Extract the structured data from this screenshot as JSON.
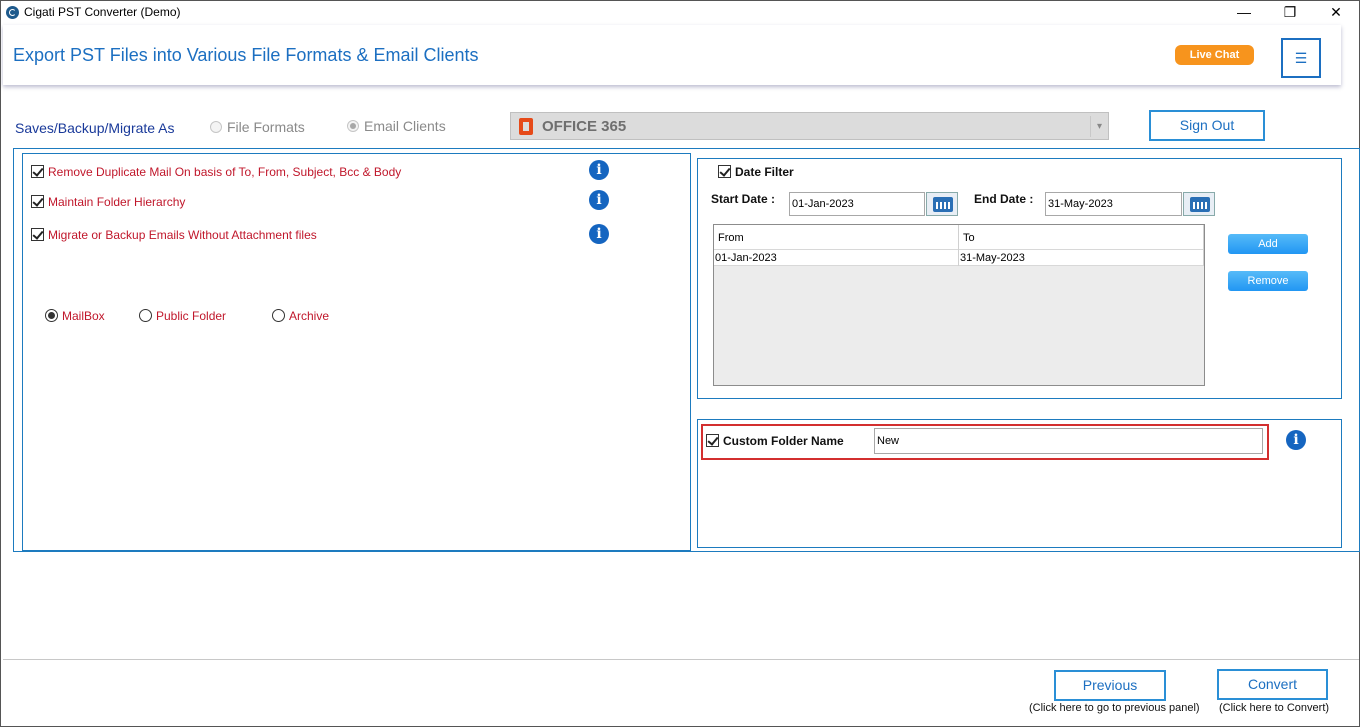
{
  "window": {
    "title": "Cigati PST Converter (Demo)",
    "controls": {
      "minimize": "—",
      "maximize": "❐",
      "close": "✕"
    }
  },
  "header": {
    "title": "Export PST Files into Various File Formats & Email Clients",
    "live_chat_label": "Live Chat",
    "menu_icon": "☰"
  },
  "saves": {
    "label": "Saves/Backup/Migrate As",
    "file_formats_label": "File Formats",
    "email_clients_label": "Email Clients",
    "selected_client": "OFFICE 365",
    "dropdown_arrow": "▾",
    "sign_out_label": "Sign Out"
  },
  "options": {
    "items": [
      {
        "label": "Remove Duplicate Mail On basis of To, From, Subject, Bcc & Body",
        "checked": true
      },
      {
        "label": "Maintain Folder Hierarchy",
        "checked": true
      },
      {
        "label": "Migrate or Backup Emails Without Attachment files",
        "checked": true
      }
    ],
    "info_glyph": "i",
    "mailbox_types": [
      {
        "label": "MailBox",
        "selected": true
      },
      {
        "label": "Public Folder",
        "selected": false
      },
      {
        "label": "Archive",
        "selected": false
      }
    ]
  },
  "date_filter": {
    "label": "Date Filter",
    "checked": true,
    "start_label": "Start Date :",
    "start_value": "01-Jan-2023",
    "end_label": "End Date :",
    "end_value": "31-May-2023",
    "grid": {
      "columns": [
        "From",
        "To"
      ],
      "rows": [
        {
          "from": "01-Jan-2023",
          "to": "31-May-2023"
        }
      ]
    },
    "add_label": "Add",
    "remove_label": "Remove"
  },
  "custom_folder": {
    "label": "Custom Folder Name",
    "checked": true,
    "value": "New"
  },
  "footer": {
    "previous_label": "Previous",
    "previous_note": "(Click here to go to previous panel)",
    "convert_label": "Convert",
    "convert_note": "(Click here to Convert)"
  },
  "colors": {
    "accent_blue": "#1c6fc1",
    "live_chat_orange": "#f7941d",
    "option_red": "#c0172b",
    "highlight_red": "#d32f2f"
  }
}
